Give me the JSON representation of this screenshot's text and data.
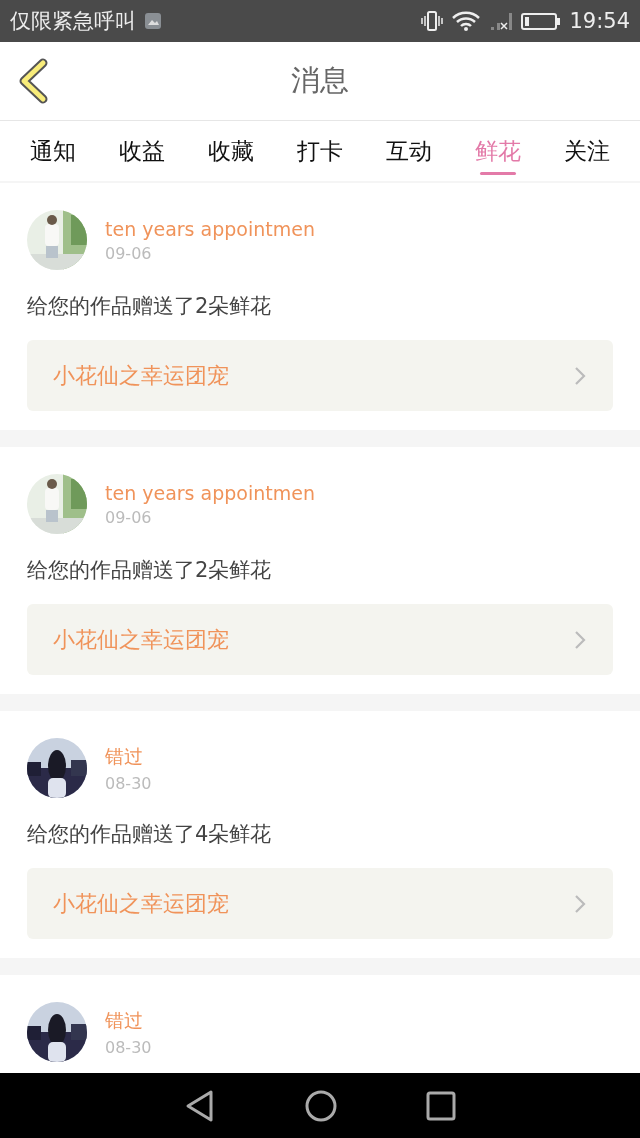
{
  "status_bar": {
    "carrier": "仅限紧急呼叫",
    "time": "19:54"
  },
  "header": {
    "title": "消息"
  },
  "tabs": [
    {
      "label": "通知",
      "selected": false
    },
    {
      "label": "收益",
      "selected": false
    },
    {
      "label": "收藏",
      "selected": false
    },
    {
      "label": "打卡",
      "selected": false
    },
    {
      "label": "互动",
      "selected": false
    },
    {
      "label": "鲜花",
      "selected": true
    },
    {
      "label": "关注",
      "selected": false
    }
  ],
  "messages": [
    {
      "name": "ten years appointmen",
      "date": "09-06",
      "text": "给您的作品赠送了2朵鲜花",
      "link": "小花仙之幸运团宠"
    },
    {
      "name": "ten years appointmen",
      "date": "09-06",
      "text": "给您的作品赠送了2朵鲜花",
      "link": "小花仙之幸运团宠"
    },
    {
      "name": "错过",
      "date": "08-30",
      "text": "给您的作品赠送了4朵鲜花",
      "link": "小花仙之幸运团宠"
    },
    {
      "name": "错过",
      "date": "08-30"
    }
  ]
}
